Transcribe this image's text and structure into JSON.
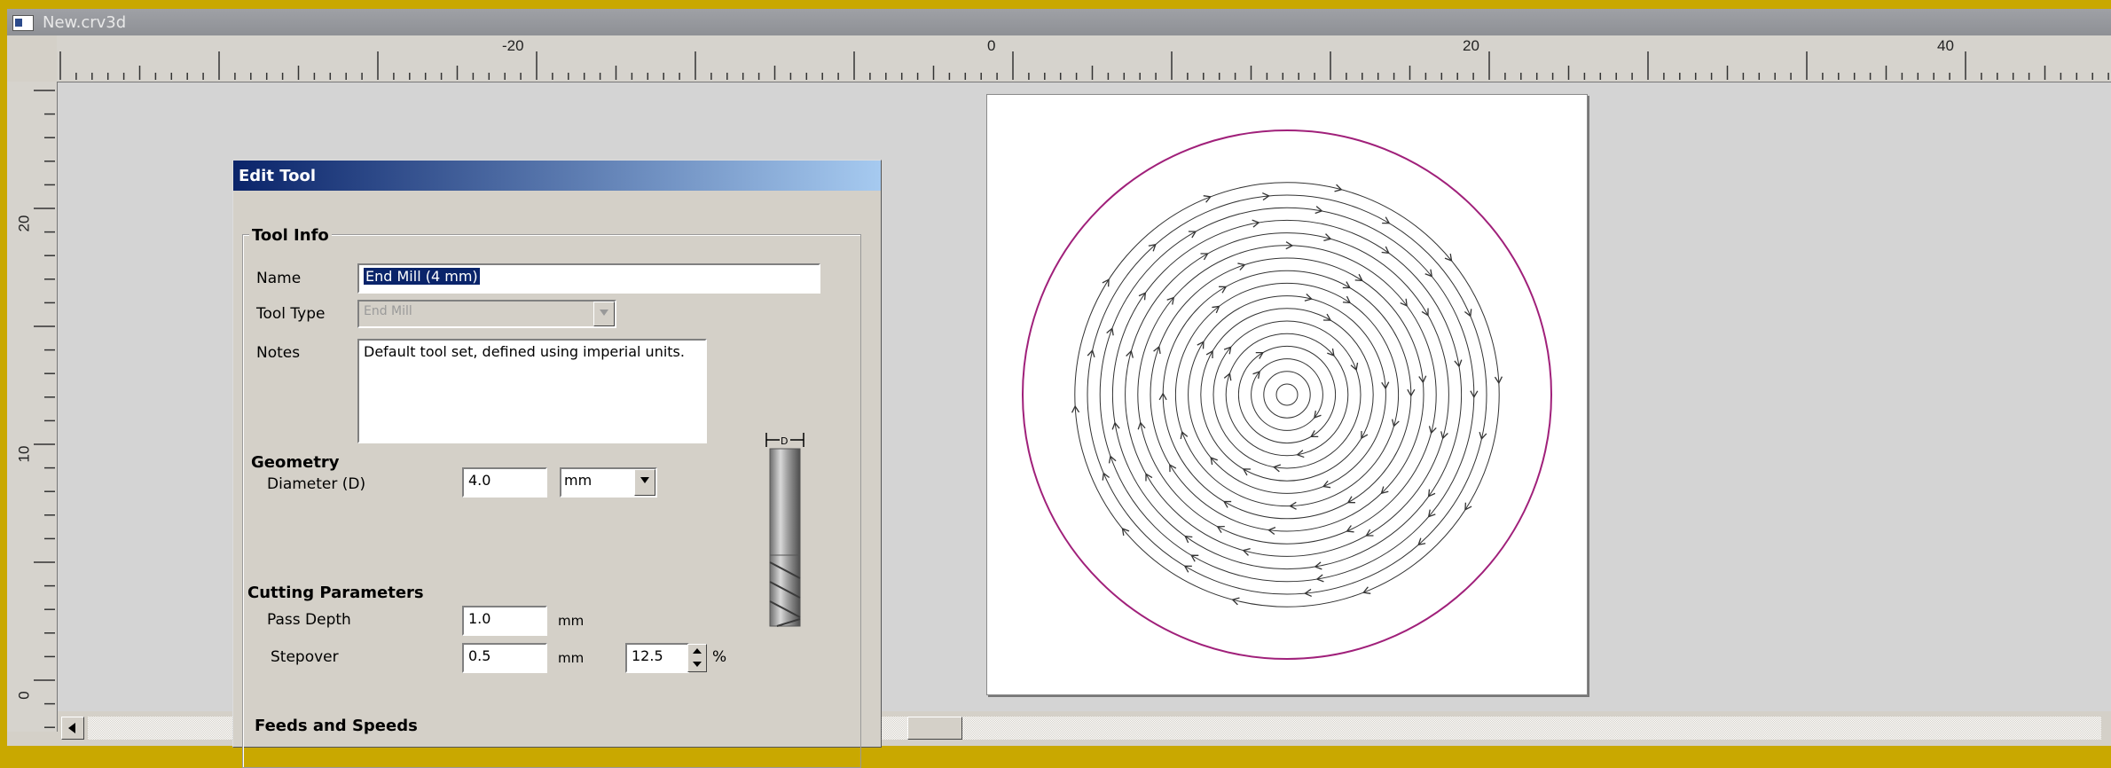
{
  "window": {
    "title": "New.crv3d"
  },
  "rulers": {
    "horizontal_labels": [
      "-20",
      "0",
      "20",
      "40"
    ],
    "vertical_labels": [
      "20",
      "10",
      "0"
    ]
  },
  "dialog": {
    "title": "Edit Tool",
    "tool_info": {
      "heading": "Tool Info",
      "name_label": "Name",
      "name_value": "End Mill (4 mm)",
      "tool_type_label": "Tool Type",
      "tool_type_value": "End Mill",
      "notes_label": "Notes",
      "notes_value": "Default tool set, defined using imperial units."
    },
    "geometry": {
      "heading": "Geometry",
      "diameter_label": "Diameter (D)",
      "diameter_value": "4.0",
      "units_value": "mm"
    },
    "tool_diagram": {
      "label": "D",
      "icon": "end-mill-icon"
    },
    "cutting_parameters": {
      "heading": "Cutting Parameters",
      "pass_depth_label": "Pass Depth",
      "pass_depth_value": "1.0",
      "pass_depth_unit": "mm",
      "stepover_label": "Stepover",
      "stepover_value": "0.5",
      "stepover_unit": "mm",
      "stepover_percent_value": "12.5",
      "percent_symbol": "%"
    },
    "feeds_speeds": {
      "heading": "Feeds and Speeds"
    }
  },
  "preview": {
    "boundary_color": "#a0207a",
    "toolpath_color": "#333333"
  }
}
